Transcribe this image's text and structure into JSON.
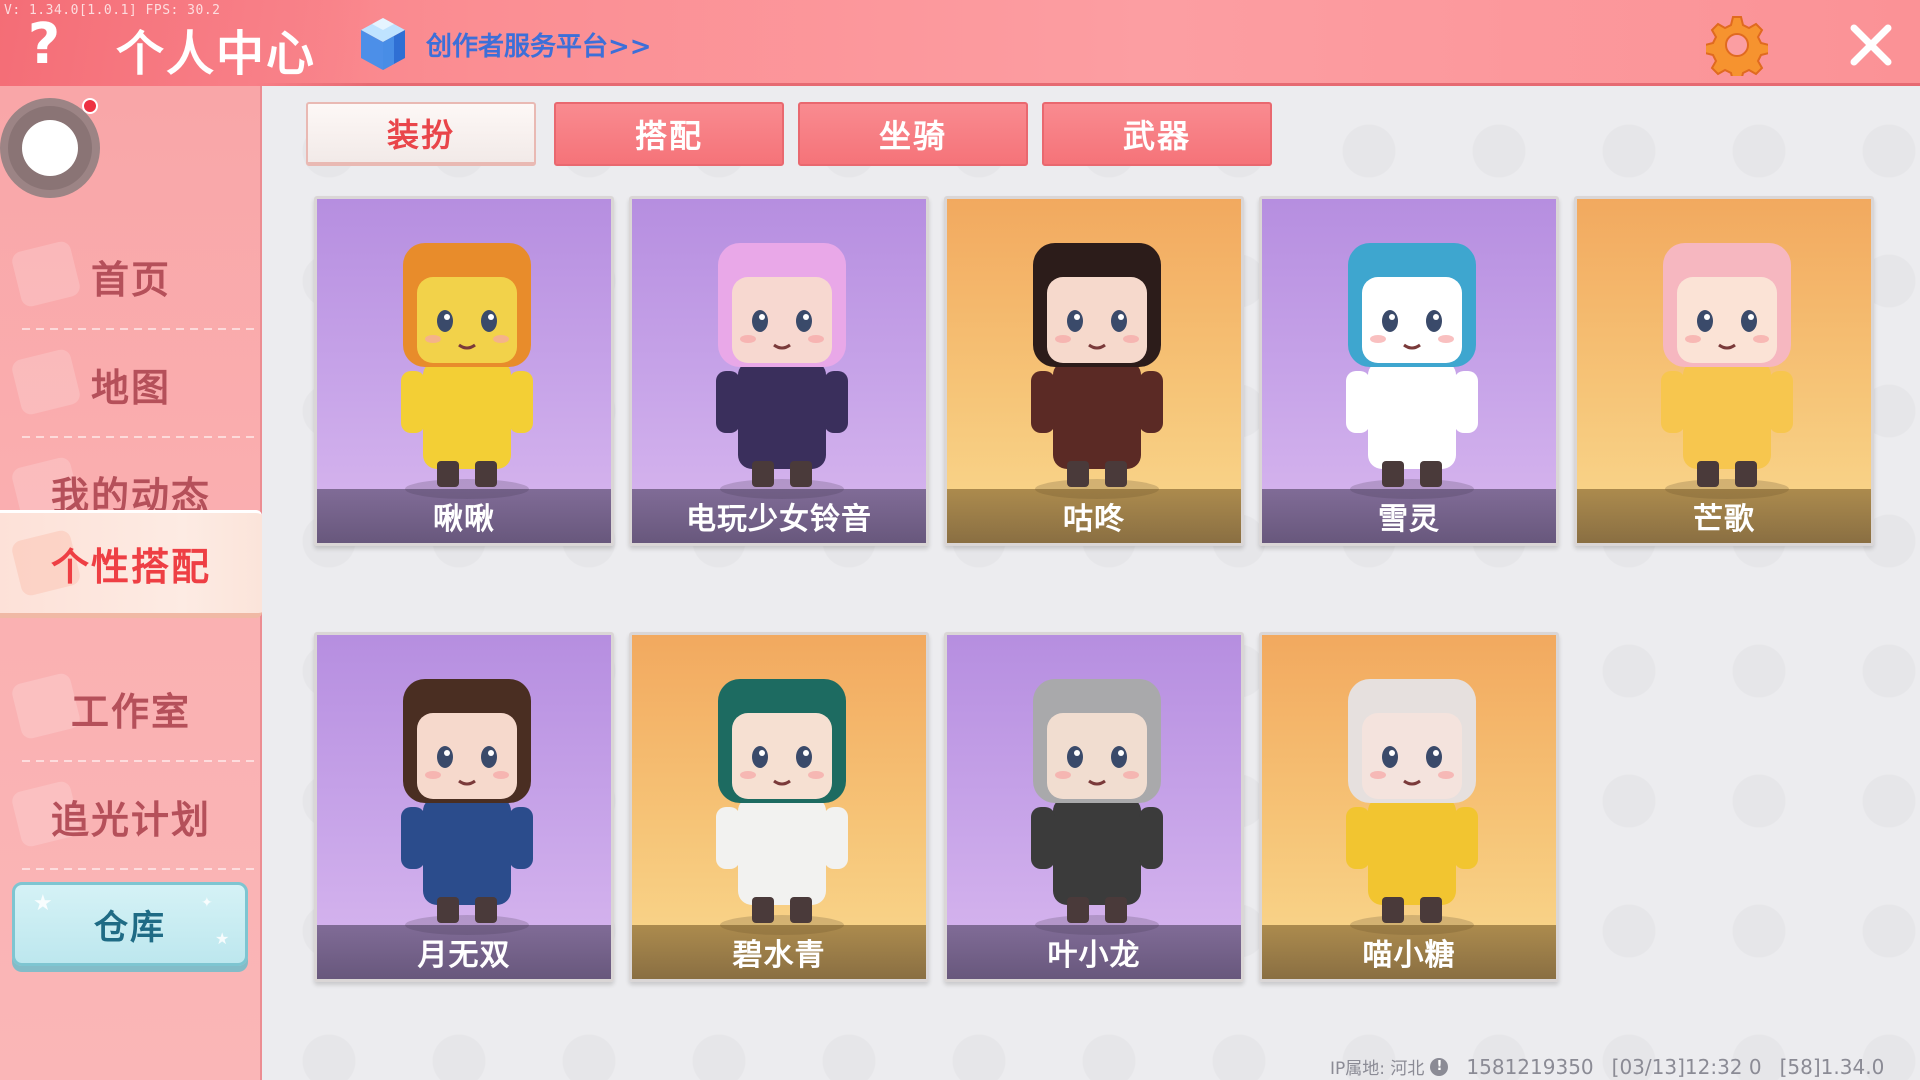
{
  "header": {
    "debug_text": "V: 1.34.0[1.0.1] FPS: 30.2",
    "help_icon": "?",
    "title": "个人中心",
    "creator_link": "创作者服务平台>>",
    "colors": {
      "header": "#fb8e93",
      "link": "#3d6fd8"
    }
  },
  "sidebar": {
    "items": [
      {
        "label": "首页"
      },
      {
        "label": "地图"
      },
      {
        "label": "我的动态"
      },
      {
        "label": "个性搭配",
        "active": true
      },
      {
        "label": "工作室"
      },
      {
        "label": "追光计划"
      }
    ],
    "warehouse_label": "仓库"
  },
  "tabs": [
    {
      "label": "装扮",
      "active": true
    },
    {
      "label": "搭配"
    },
    {
      "label": "坐骑"
    },
    {
      "label": "武器"
    }
  ],
  "cards": [
    {
      "name": "啾啾",
      "bg": "purple"
    },
    {
      "name": "电玩少女铃音",
      "bg": "purple"
    },
    {
      "name": "咕咚",
      "bg": "orange"
    },
    {
      "name": "雪灵",
      "bg": "purple"
    },
    {
      "name": "芒歌",
      "bg": "orange"
    },
    {
      "name": "月无双",
      "bg": "purple"
    },
    {
      "name": "碧水青",
      "bg": "orange"
    },
    {
      "name": "叶小龙",
      "bg": "purple"
    },
    {
      "name": "喵小糖",
      "bg": "orange"
    }
  ],
  "footer": {
    "ip_label": "IP属地: 河北",
    "info_icon": "!",
    "uid": "1581219350",
    "timestamp": "[03/13]12:32 0",
    "version": "[58]1.34.0"
  }
}
